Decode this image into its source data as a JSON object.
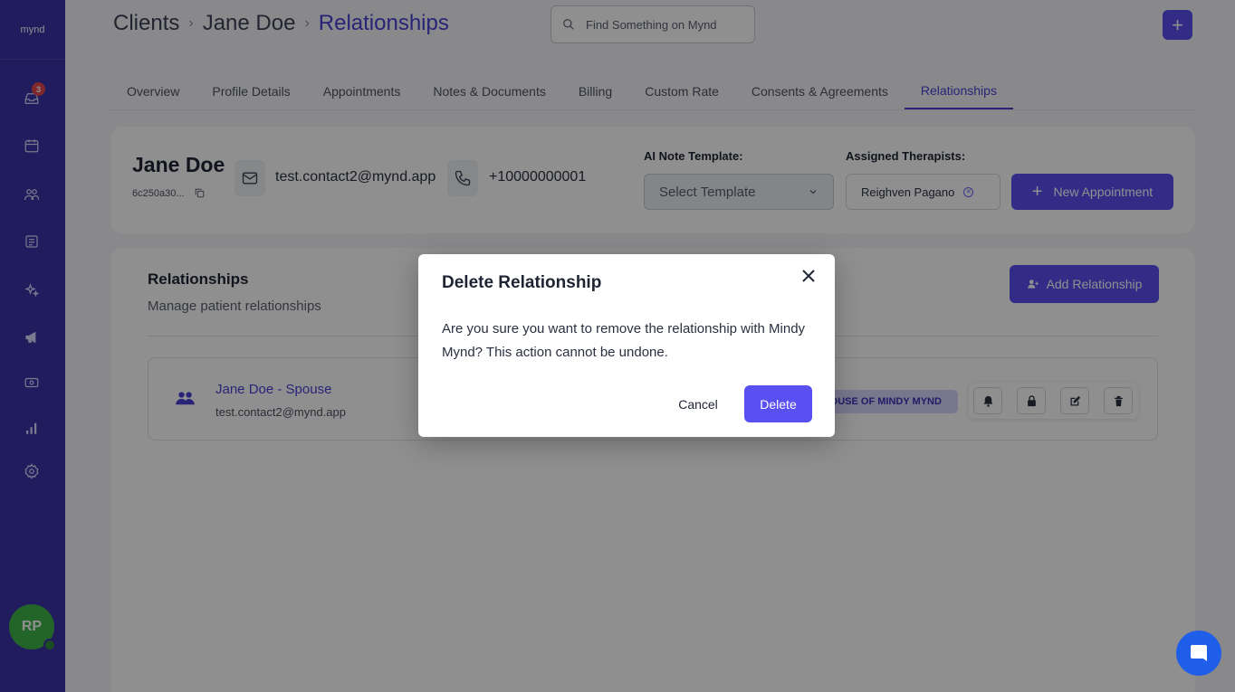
{
  "app": {
    "logo_text": "mynd"
  },
  "sidebar": {
    "inbox_badge": "3",
    "items": [
      {
        "name": "inbox-icon"
      },
      {
        "name": "calendar-icon"
      },
      {
        "name": "clients-icon"
      },
      {
        "name": "notes-icon"
      },
      {
        "name": "ai-sparkle-icon"
      },
      {
        "name": "megaphone-icon"
      },
      {
        "name": "billing-icon"
      },
      {
        "name": "reports-icon"
      },
      {
        "name": "settings-icon"
      }
    ],
    "user_initials": "RP"
  },
  "header": {
    "breadcrumb": [
      "Clients",
      "Jane Doe",
      "Relationships"
    ],
    "separator": "›",
    "search_placeholder": "Find Something on Mynd",
    "add_label": "+"
  },
  "tabs": [
    {
      "label": "Overview"
    },
    {
      "label": "Profile Details"
    },
    {
      "label": "Appointments"
    },
    {
      "label": "Notes & Documents"
    },
    {
      "label": "Billing"
    },
    {
      "label": "Custom Rate"
    },
    {
      "label": "Consents & Agreements"
    },
    {
      "label": "Relationships",
      "active": true
    }
  ],
  "client": {
    "name": "Jane Doe",
    "id_short": "6c250a30...",
    "email": "test.contact2@mynd.app",
    "phone": "+10000000001",
    "ai_template_label": "AI Note Template:",
    "ai_template_value": "Select Template",
    "therapists_label": "Assigned Therapists:",
    "therapist": "Reighven Pagano",
    "new_appointment_label": "New Appointment"
  },
  "relationships": {
    "title": "Relationships",
    "subtitle": "Manage patient relationships",
    "add_label": "Add Relationship",
    "items": [
      {
        "name": "Jane Doe - Spouse",
        "email": "test.contact2@mynd.app",
        "badge": "SPOUSE OF MINDY MYND"
      }
    ]
  },
  "modal": {
    "title": "Delete Relationship",
    "body": "Are you sure you want to remove the relationship with Mindy Mynd? This action cannot be undone.",
    "cancel_label": "Cancel",
    "delete_label": "Delete"
  },
  "colors": {
    "sidebar": "#3a32a8",
    "accent": "#5a4ff0",
    "accent_text": "#4a3fd6",
    "avatar": "#3fb24a",
    "chat": "#1f5ee8"
  }
}
